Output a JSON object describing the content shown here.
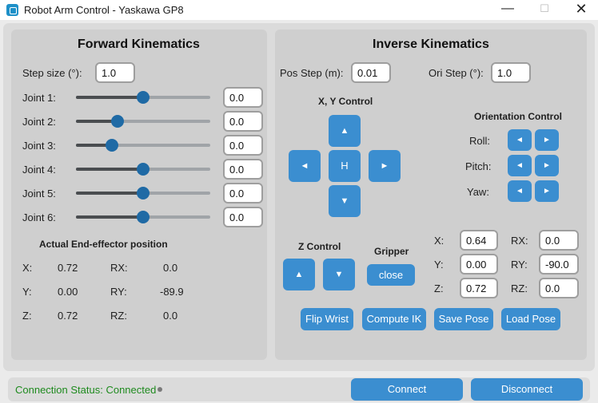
{
  "window": {
    "title": "Robot Arm Control - Yaskawa GP8",
    "minimize": "—",
    "maximize": "☐",
    "close": "✕"
  },
  "fk": {
    "title": "Forward Kinematics",
    "step_label": "Step size (°):",
    "step_value": "1.0",
    "joints": [
      {
        "label": "Joint 1:",
        "value": "0.0",
        "slider": 0.5
      },
      {
        "label": "Joint 2:",
        "value": "0.0",
        "slider": 0.31
      },
      {
        "label": "Joint 3:",
        "value": "0.0",
        "slider": 0.27
      },
      {
        "label": "Joint 4:",
        "value": "0.0",
        "slider": 0.5
      },
      {
        "label": "Joint 5:",
        "value": "0.0",
        "slider": 0.5
      },
      {
        "label": "Joint 6:",
        "value": "0.0",
        "slider": 0.5
      }
    ],
    "actual_title": "Actual End-effector position",
    "actual": {
      "x_label": "X:",
      "x": "0.72",
      "rx_label": "RX:",
      "rx": "0.0",
      "y_label": "Y:",
      "y": "0.00",
      "ry_label": "RY:",
      "ry": "-89.9",
      "z_label": "Z:",
      "z": "0.72",
      "rz_label": "RZ:",
      "rz": "0.0"
    }
  },
  "ik": {
    "title": "Inverse Kinematics",
    "pos_step_label": "Pos Step (m):",
    "pos_step": "0.01",
    "ori_step_label": "Ori Step (°):",
    "ori_step": "1.0",
    "xy_title": "X, Y Control",
    "up": "▲",
    "down": "▼",
    "left": "◄",
    "right": "►",
    "home": "H",
    "orient_title": "Orientation Control",
    "roll": "Roll:",
    "pitch": "Pitch:",
    "yaw": "Yaw:",
    "minus": "◄",
    "plus": "►",
    "z_title": "Z Control",
    "gripper_title": "Gripper",
    "gripper_btn": "close",
    "target": {
      "x_label": "X:",
      "x": "0.64",
      "rx_label": "RX:",
      "rx": "0.0",
      "y_label": "Y:",
      "y": "0.00",
      "ry_label": "RY:",
      "ry": "-90.0",
      "z_label": "Z:",
      "z": "0.72",
      "rz_label": "RZ:",
      "rz": "0.0"
    },
    "actions": {
      "flip": "Flip Wrist",
      "compute": "Compute IK",
      "save": "Save Pose",
      "load": "Load Pose"
    }
  },
  "status": {
    "text": "Connection Status: Connected",
    "color": "#1e8a1e",
    "connect": "Connect",
    "disconnect": "Disconnect"
  }
}
